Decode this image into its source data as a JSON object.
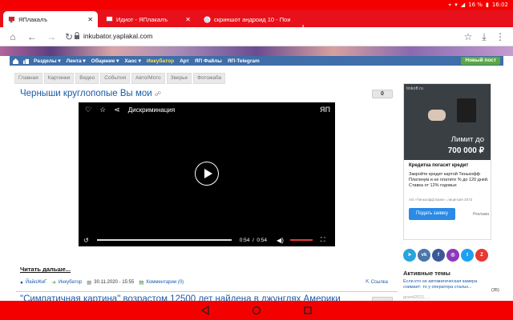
{
  "status_bar": {
    "battery": "16 %",
    "time": "16:02",
    "bg_color": "#f50000"
  },
  "tabs": [
    {
      "title": "ЯПлакалъ",
      "active": true
    },
    {
      "title": "Идиот - ЯПлакалъ",
      "active": false
    },
    {
      "title": "скриншот андроид 10 - Пои",
      "active": false
    }
  ],
  "toolbar": {
    "url": "inkubator.yaplakal.com"
  },
  "site_nav": {
    "items": [
      "Разделы ▾",
      "Лента ▾",
      "Общение ▾",
      "Хаос ▾",
      "Инкубатор",
      "Арт",
      "ЯП Файлы",
      "ЯП-Telegram"
    ],
    "highlight_index": 4,
    "new_post": "Новый пост"
  },
  "subnav": [
    "Главная",
    "Картинки",
    "Видео",
    "События",
    "Авто/Мото",
    "Зверье",
    "Фотожаба"
  ],
  "post": {
    "title": "Черныши круглопопые Вы мои",
    "count": "0",
    "video": {
      "title": "Дискриминация",
      "logo": "ЯП",
      "current_time": "0:54",
      "duration": "0:54",
      "progress": 1.0
    },
    "read_more": "Читать дальше...",
    "author": "ЙайоЖиГ",
    "section": "Инкубатор",
    "date": "30.11.2020 - 15:55",
    "comments": "Комментарии (0)",
    "share": "Ссылка"
  },
  "next_post": {
    "title": "\"Симпатичная картина\" возрастом 12500 лет найдена в джунглях Америки"
  },
  "ad": {
    "brand": "tinkoff.ru",
    "big_line1": "Лимит до",
    "big_line2": "700 000 ₽",
    "headline": "Кредитка погасит кредит",
    "text": "Закройте кредит картой Тинькофф Платинум и не платите % до 120 дней. Ставка от 12% годовых",
    "legal": "АО «Тинькофф Банк», лицензия 2673",
    "button": "Подать заявку",
    "mark": "Реклама"
  },
  "social": [
    {
      "name": "telegram",
      "label": "➤",
      "color": "#2aa3dc"
    },
    {
      "name": "vk",
      "label": "vk",
      "color": "#4a76a8"
    },
    {
      "name": "facebook",
      "label": "f",
      "color": "#3b5998"
    },
    {
      "name": "instagram",
      "label": "◎",
      "color": "#8a3ab9"
    },
    {
      "name": "twitter",
      "label": "t",
      "color": "#1da1f2"
    },
    {
      "name": "yaplakal",
      "label": "Z",
      "color": "#e53935"
    }
  ],
  "topics": {
    "heading": "Активные темы",
    "items": [
      {
        "title": "Если кто не автоматическая камера снимает: то у оператора стальн...",
        "count": "(35)"
      },
      {
        "title": "grand2021, ...",
        "count": ""
      }
    ]
  }
}
